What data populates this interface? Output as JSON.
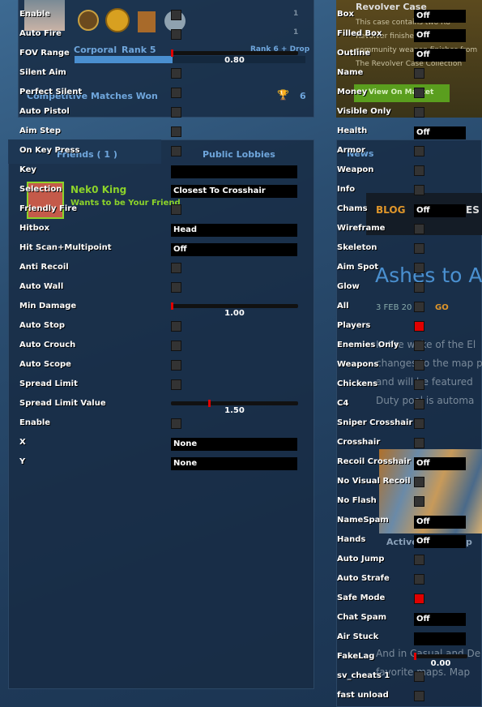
{
  "background": {
    "profile": {
      "rank_name": "Corporal",
      "rank_label": "Rank 5",
      "next_rank": "Rank 6 + Drop",
      "count1": "1",
      "count2": "1",
      "competitive_label": "Competitive Matches Won",
      "competitive_count": "6"
    },
    "friends": {
      "tab_friends": "Friends ( 1 )",
      "tab_lobbies": "Public Lobbies",
      "friend_name": "Nek0 King",
      "friend_status": "Wants to be Your Friend"
    },
    "store": {
      "title": "Revolver Case",
      "description": "This case contains two R8 Revolver finishes and 15 community weapon finishes from The Revolver Case Collection",
      "market_button": "View On Market"
    },
    "news": {
      "header": "News",
      "blog": "BLOG",
      "blog_suffix": "ES",
      "headline": "Ashes to A",
      "date": "3 FEB 20",
      "tag": "GO",
      "body": [
        "In the wake of the El",
        "changes to the map p",
        "and will be featured",
        "Duty pool is automa"
      ],
      "active_label": "Active",
      "active_suffix": "p",
      "footer": [
        "And in Casual and De",
        "favorite maps. Map"
      ]
    }
  },
  "left_menu": [
    {
      "label": "Enable",
      "type": "checkbox",
      "checked": false
    },
    {
      "label": "Auto Fire",
      "type": "checkbox",
      "checked": false
    },
    {
      "label": "FOV Range",
      "type": "slider",
      "value": "0.80",
      "fraction": 0.0
    },
    {
      "label": "Silent Aim",
      "type": "checkbox",
      "checked": false
    },
    {
      "label": "Perfect Silent",
      "type": "checkbox",
      "checked": false
    },
    {
      "label": "Auto Pistol",
      "type": "checkbox",
      "checked": false
    },
    {
      "label": "Aim Step",
      "type": "checkbox",
      "checked": false
    },
    {
      "label": "On Key Press",
      "type": "checkbox",
      "checked": false
    },
    {
      "label": "Key",
      "type": "dropdown",
      "value": ""
    },
    {
      "label": "Selection",
      "type": "dropdown",
      "value": "Closest To Crosshair"
    },
    {
      "label": "Friendly Fire",
      "type": "checkbox",
      "checked": false
    },
    {
      "label": "Hitbox",
      "type": "dropdown",
      "value": "Head"
    },
    {
      "label": "Hit Scan+Multipoint",
      "type": "dropdown",
      "value": "Off"
    },
    {
      "label": "Anti Recoil",
      "type": "checkbox",
      "checked": false
    },
    {
      "label": "Auto Wall",
      "type": "checkbox",
      "checked": false
    },
    {
      "label": "Min Damage",
      "type": "slider",
      "value": "1.00",
      "fraction": 0.0
    },
    {
      "label": "Auto Stop",
      "type": "checkbox",
      "checked": false
    },
    {
      "label": "Auto Crouch",
      "type": "checkbox",
      "checked": false
    },
    {
      "label": "Auto Scope",
      "type": "checkbox",
      "checked": false
    },
    {
      "label": "Spread Limit",
      "type": "checkbox",
      "checked": false
    },
    {
      "label": "Spread Limit Value",
      "type": "slider",
      "value": "1.50",
      "fraction": 0.3
    },
    {
      "label": "Enable",
      "type": "checkbox",
      "checked": false
    },
    {
      "label": "X",
      "type": "dropdown",
      "value": "None"
    },
    {
      "label": "Y",
      "type": "dropdown",
      "value": "None"
    }
  ],
  "right_menu": [
    {
      "label": "Box",
      "type": "dropdown",
      "value": "Off"
    },
    {
      "label": "Filled Box",
      "type": "dropdown",
      "value": "Off"
    },
    {
      "label": "Outline",
      "type": "dropdown",
      "value": "Off"
    },
    {
      "label": "Name",
      "type": "checkbox",
      "checked": false
    },
    {
      "label": "Money",
      "type": "checkbox",
      "checked": false
    },
    {
      "label": "Visible Only",
      "type": "checkbox",
      "checked": false
    },
    {
      "label": "Health",
      "type": "dropdown",
      "value": "Off"
    },
    {
      "label": "Armor",
      "type": "checkbox",
      "checked": false
    },
    {
      "label": "Weapon",
      "type": "checkbox",
      "checked": false
    },
    {
      "label": "Info",
      "type": "checkbox",
      "checked": false
    },
    {
      "label": "Chams",
      "type": "dropdown",
      "value": "Off"
    },
    {
      "label": "Wireframe",
      "type": "checkbox",
      "checked": false
    },
    {
      "label": "Skeleton",
      "type": "checkbox",
      "checked": false
    },
    {
      "label": "Aim Spot",
      "type": "checkbox",
      "checked": false
    },
    {
      "label": "Glow",
      "type": "checkbox",
      "checked": false
    },
    {
      "label": "All",
      "type": "checkbox",
      "checked": false
    },
    {
      "label": "Players",
      "type": "checkbox",
      "checked": true
    },
    {
      "label": "Enemies Only",
      "type": "checkbox",
      "checked": false
    },
    {
      "label": "Weapons",
      "type": "checkbox",
      "checked": false
    },
    {
      "label": "Chickens",
      "type": "checkbox",
      "checked": false
    },
    {
      "label": "C4",
      "type": "checkbox",
      "checked": false
    },
    {
      "label": "Sniper Crosshair",
      "type": "checkbox",
      "checked": false
    },
    {
      "label": "Crosshair",
      "type": "checkbox",
      "checked": false
    },
    {
      "label": "Recoil Crosshair",
      "type": "dropdown",
      "value": "Off"
    },
    {
      "label": "No Visual Recoil",
      "type": "checkbox",
      "checked": false
    },
    {
      "label": "No Flash",
      "type": "checkbox",
      "checked": false
    },
    {
      "label": "NameSpam",
      "type": "dropdown",
      "value": "Off"
    },
    {
      "label": "Hands",
      "type": "dropdown",
      "value": "Off"
    },
    {
      "label": "Auto Jump",
      "type": "checkbox",
      "checked": false
    },
    {
      "label": "Auto Strafe",
      "type": "checkbox",
      "checked": false
    },
    {
      "label": "Safe Mode",
      "type": "checkbox",
      "checked": true
    },
    {
      "label": "Chat Spam",
      "type": "dropdown",
      "value": "Off"
    },
    {
      "label": "Air Stuck",
      "type": "dropdown",
      "value": ""
    },
    {
      "label": "FakeLag",
      "type": "slider",
      "value": "0.00",
      "fraction": 0.0
    },
    {
      "label": "sv_cheats 1",
      "type": "checkbox",
      "checked": false
    },
    {
      "label": "fast unload",
      "type": "checkbox",
      "checked": false
    }
  ],
  "colors": {
    "checked": "#e00000",
    "unchecked": "#333333",
    "friend_green": "#8cd32a",
    "market_green": "#5a9e1e",
    "blog_orange": "#e0962a"
  }
}
